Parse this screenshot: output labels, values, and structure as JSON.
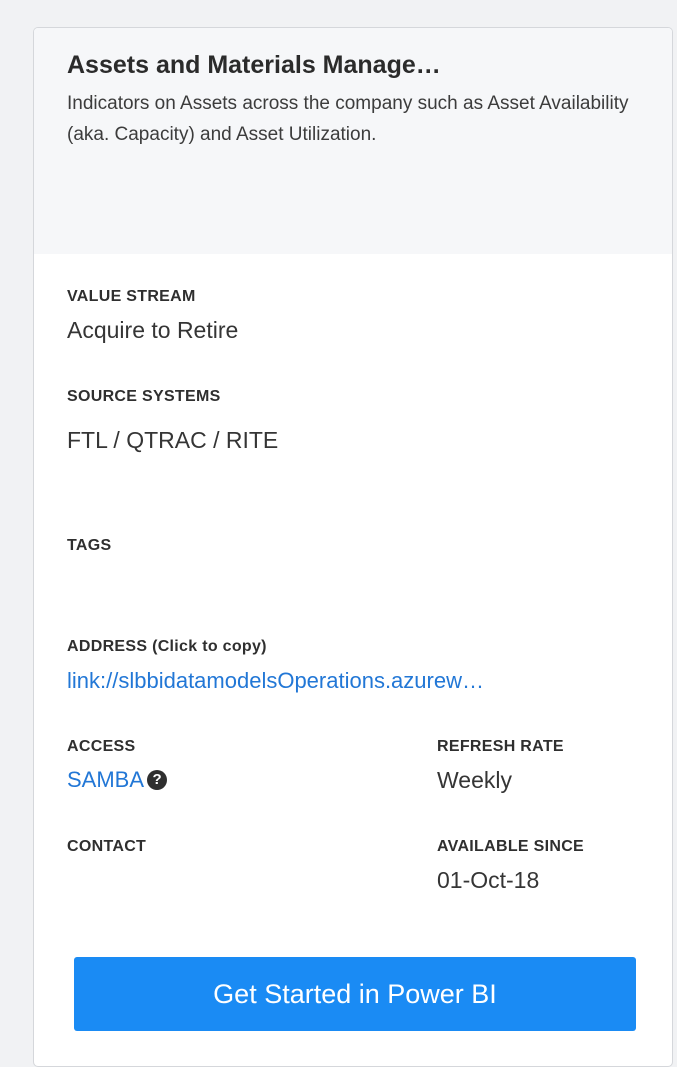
{
  "card": {
    "title": "Assets and Materials Manage…",
    "description": "Indicators on Assets across the company such as Asset Availability (aka. Capacity) and Asset Utilization.",
    "value_stream": {
      "label": "VALUE STREAM",
      "value": "Acquire to Retire"
    },
    "source_systems": {
      "label": "SOURCE SYSTEMS",
      "value": "FTL / QTRAC / RITE"
    },
    "tags": {
      "label": "TAGS"
    },
    "address": {
      "label": "ADDRESS (Click to copy)",
      "value": "link://slbbidatamodelsOperations.azurew…"
    },
    "access": {
      "label": "ACCESS",
      "value": "SAMBA",
      "help_icon": "question-circle-icon"
    },
    "refresh_rate": {
      "label": "REFRESH RATE",
      "value": "Weekly"
    },
    "contact": {
      "label": "CONTACT"
    },
    "available_since": {
      "label": "AVAILABLE SINCE",
      "value": "01-Oct-18"
    },
    "cta_label": "Get Started in Power BI"
  },
  "colors": {
    "link": "#2277d6",
    "cta_background": "#1a8bf4",
    "header_background": "#f6f7f9"
  }
}
